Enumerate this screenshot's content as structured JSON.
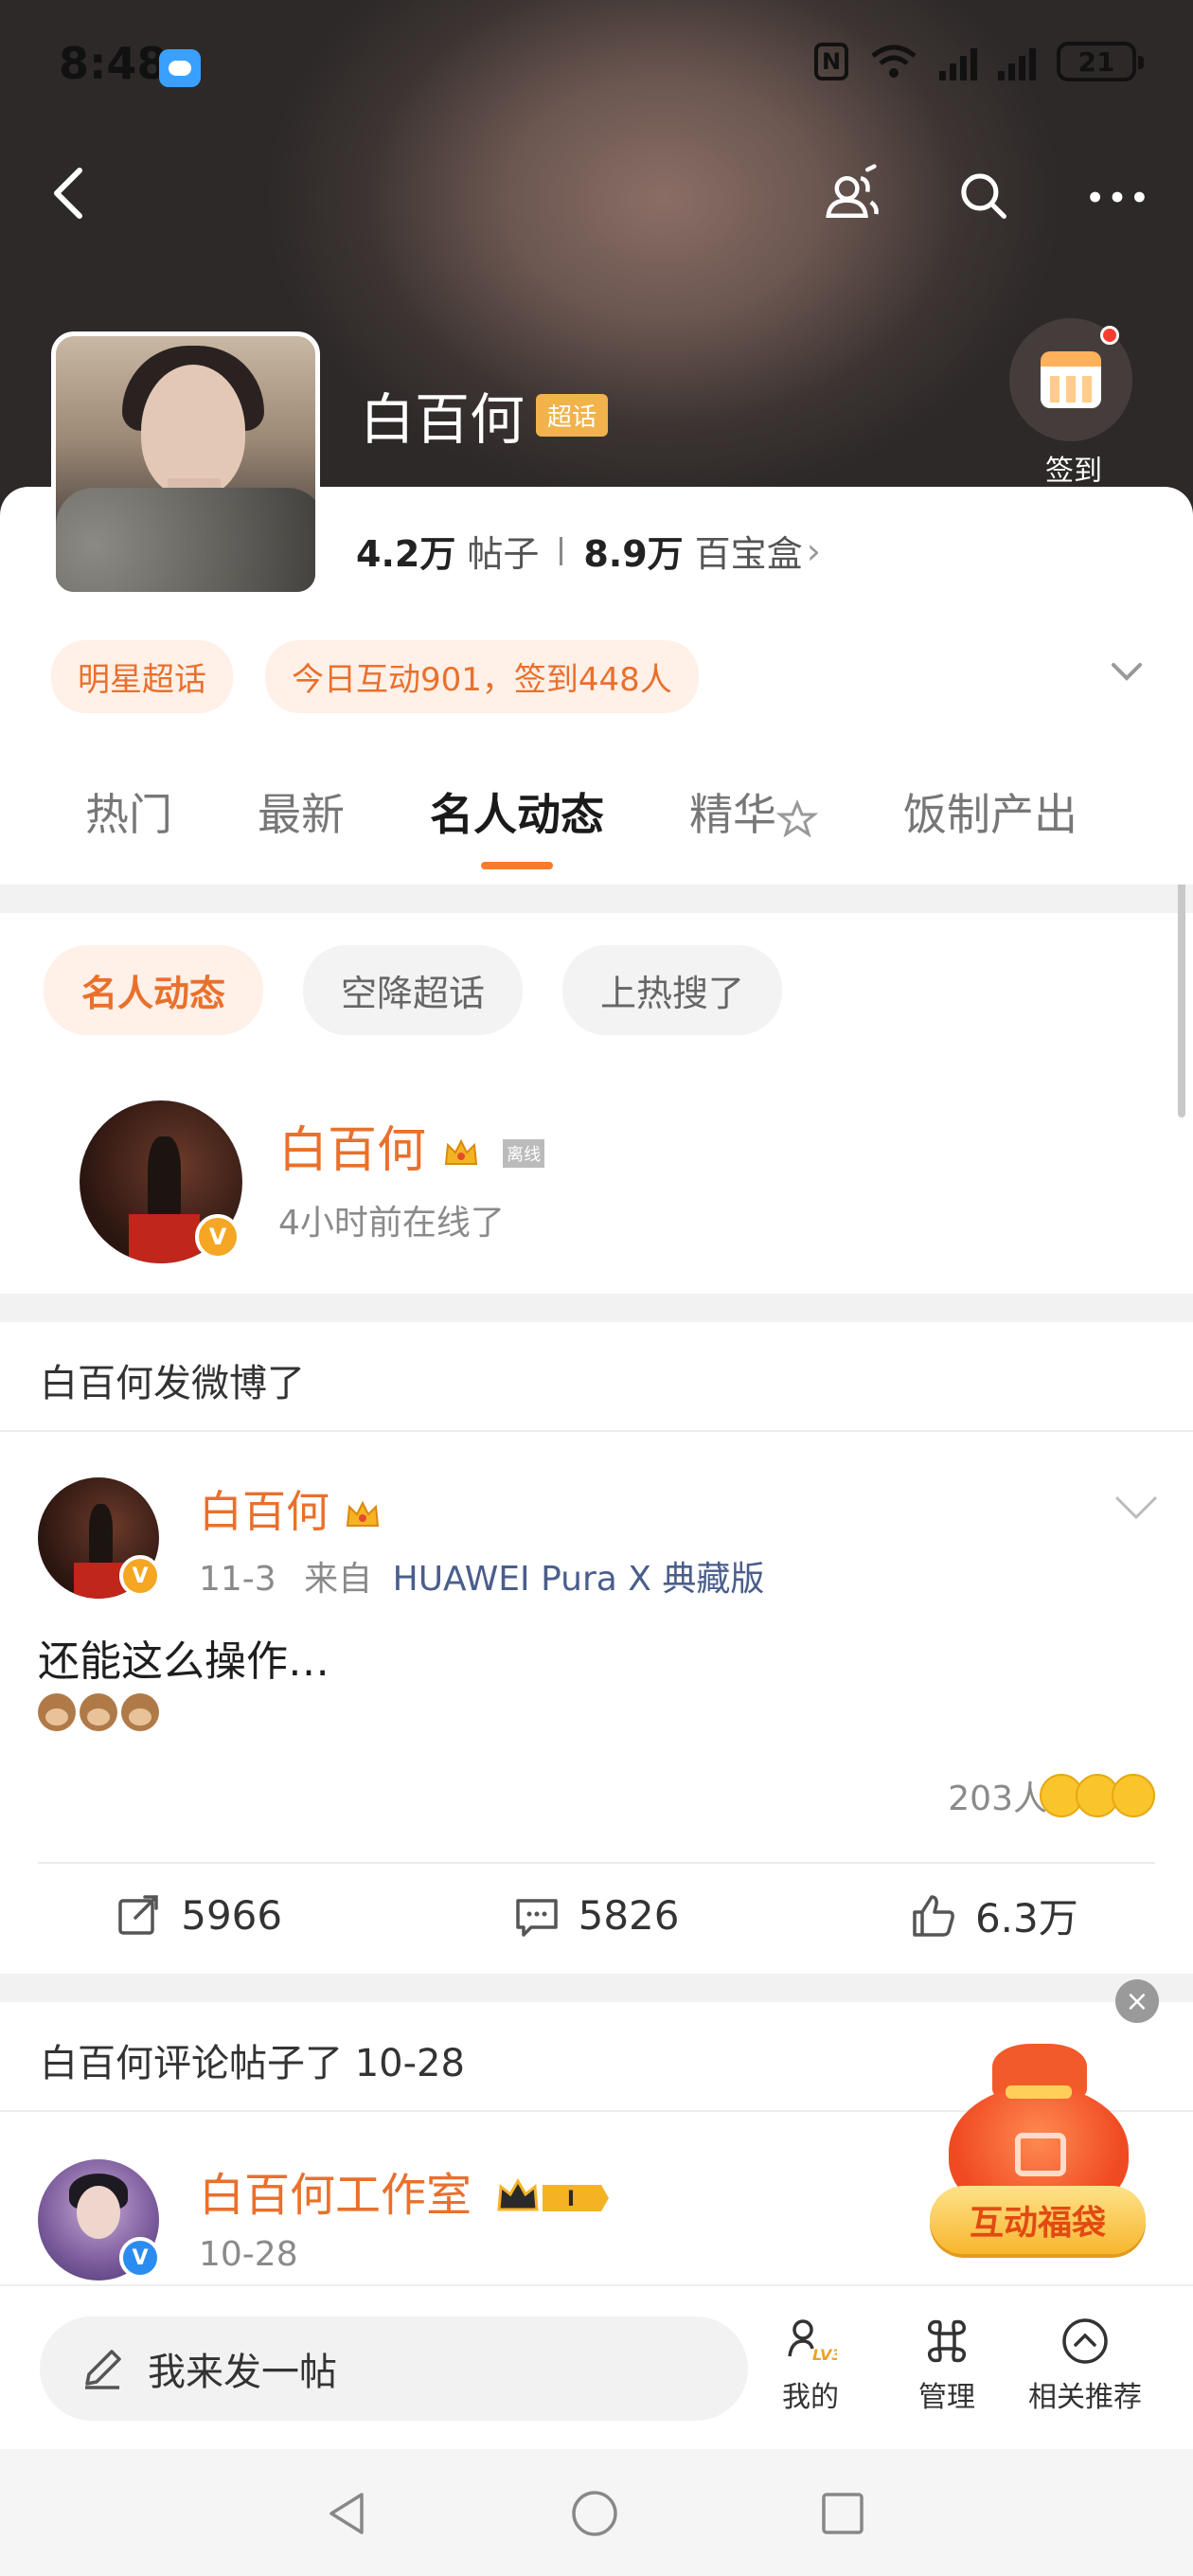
{
  "status_bar": {
    "time": "8:48",
    "nfc": "N",
    "battery": "21"
  },
  "header": {
    "topic_name": "白百何",
    "topic_tag": "超话",
    "checkin_label": "签到"
  },
  "stats": {
    "posts_value": "4.2万",
    "posts_label": "帖子",
    "box_value": "8.9万",
    "box_label": "百宝盒",
    "chevron": "›"
  },
  "chips": [
    "明星超话",
    "今日互动901，签到448人"
  ],
  "tabs": [
    "热门",
    "最新",
    "名人动态",
    "精华",
    "饭制产出"
  ],
  "sub_chips": [
    "名人动态",
    "空降超话",
    "上热搜了"
  ],
  "celeb": {
    "name": "白百何",
    "offline_tag": "离线",
    "status": "4小时前在线了",
    "badge": "V"
  },
  "section1": {
    "label": "白百何发微博了"
  },
  "post": {
    "name": "白百何",
    "date": "11-3",
    "from": "来自",
    "source": "HUAWEI Pura X 典藏版",
    "text": "还能这么操作…",
    "reactions_count": "203人",
    "reposts": "5966",
    "comments": "5826",
    "likes": "6.3万"
  },
  "section2": {
    "label": "白百何评论帖子了 10-28"
  },
  "post2": {
    "name": "白百何工作室",
    "date": "10-28",
    "vip_level": "I"
  },
  "lucky_bag": {
    "label": "互动福袋",
    "close": "×"
  },
  "bottom_bar": {
    "compose_placeholder": "我来发一帖",
    "mine": "我的",
    "manage": "管理",
    "related": "相关推荐"
  },
  "colors": {
    "accent": "#e9702c",
    "tab_indicator": "#f77b2a",
    "link": "#4a5e8c"
  }
}
